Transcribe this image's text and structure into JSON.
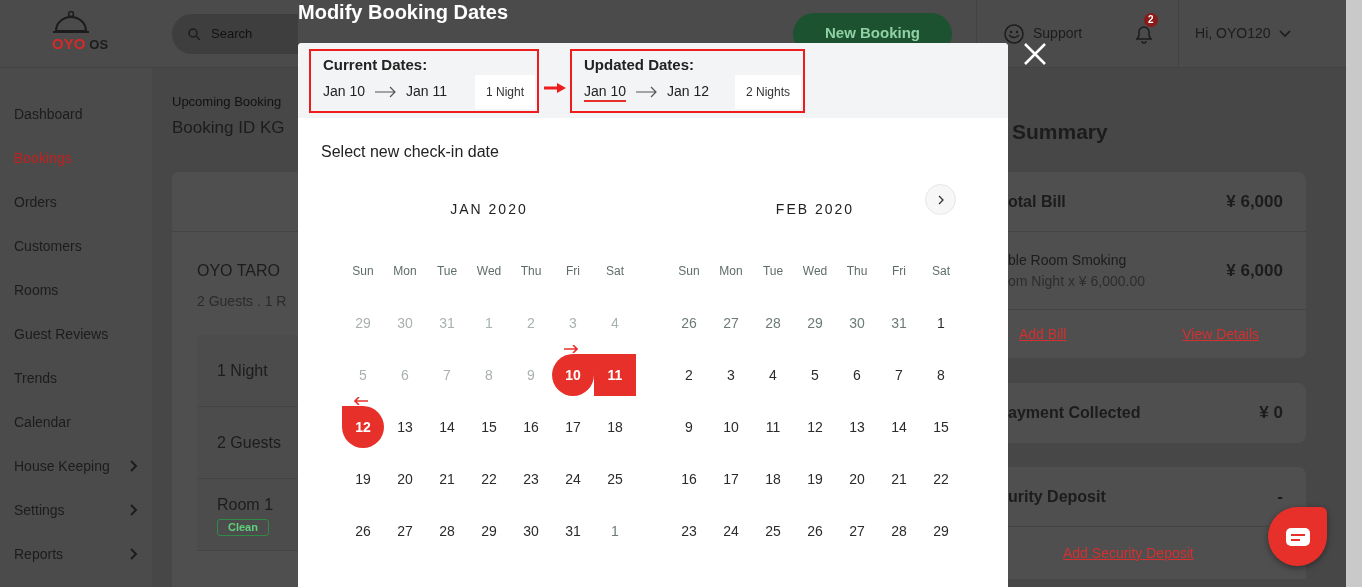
{
  "header": {
    "logo": {
      "brand": "OYO",
      "product": "OS"
    },
    "search": {
      "placeholder": "Search"
    },
    "new_booking": "New Booking",
    "support": "Support",
    "notifications": {
      "count": "2"
    },
    "user": "Hi, OYO120"
  },
  "sidebar": {
    "items": [
      {
        "label": "Dashboard",
        "selected": false,
        "expandable": false
      },
      {
        "label": "Bookings",
        "selected": true,
        "expandable": false
      },
      {
        "label": "Orders",
        "selected": false,
        "expandable": false
      },
      {
        "label": "Customers",
        "selected": false,
        "expandable": false
      },
      {
        "label": "Rooms",
        "selected": false,
        "expandable": false
      },
      {
        "label": "Guest Reviews",
        "selected": false,
        "expandable": false
      },
      {
        "label": "Trends",
        "selected": false,
        "expandable": false
      },
      {
        "label": "Calendar",
        "selected": false,
        "expandable": false
      },
      {
        "label": "House Keeping",
        "selected": false,
        "expandable": true
      },
      {
        "label": "Settings",
        "selected": false,
        "expandable": true
      },
      {
        "label": "Reports",
        "selected": false,
        "expandable": true
      }
    ]
  },
  "booking": {
    "breadcrumb": "Upcoming Booking",
    "title": "Booking ID KG",
    "guest_name": "OYO TARO",
    "subtitle": "2 Guests . 1 R",
    "details": [
      {
        "kind": "text",
        "label": "1 Night"
      },
      {
        "kind": "text",
        "label": "2 Guests"
      },
      {
        "kind": "room",
        "label": "Room 1",
        "status": "Clean"
      }
    ]
  },
  "summary": {
    "title": "Summary",
    "bill": {
      "label": "otal Bill",
      "amount": "¥ 6,000",
      "items": [
        {
          "name": "ble Room Smoking",
          "detail": "om Night x ¥ 6,000.00",
          "amount": "¥ 6,000"
        }
      ],
      "actions": [
        "Add Bill",
        "View Details"
      ]
    },
    "payment": {
      "label": "ayment Collected",
      "amount": "¥ 0"
    },
    "deposit": {
      "label": "urity Deposit",
      "amount": "-",
      "action": "Add Security Deposit"
    }
  },
  "modal": {
    "title": "Modify Booking Dates",
    "current": {
      "label": "Current Dates:",
      "check_in": "Jan 10",
      "check_out": "Jan 11",
      "nights": "1 Night",
      "highlighted": true,
      "check_in_active": false
    },
    "updated": {
      "label": "Updated Dates:",
      "check_in": "Jan 10",
      "check_out": "Jan 12",
      "nights": "2 Nights",
      "highlighted": true,
      "check_in_active": true
    },
    "annotation_arrow": true,
    "prompt": "Select new check-in date",
    "months": [
      {
        "title": "JAN 2020",
        "weekdays": [
          "Sun",
          "Mon",
          "Tue",
          "Wed",
          "Thu",
          "Fri",
          "Sat"
        ],
        "days": [
          {
            "d": "29",
            "kind": "disabled"
          },
          {
            "d": "30",
            "kind": "disabled"
          },
          {
            "d": "31",
            "kind": "disabled"
          },
          {
            "d": "1",
            "kind": "disabled"
          },
          {
            "d": "2",
            "kind": "disabled"
          },
          {
            "d": "3",
            "kind": "disabled"
          },
          {
            "d": "4",
            "kind": "disabled"
          },
          {
            "d": "5",
            "kind": "disabled"
          },
          {
            "d": "6",
            "kind": "disabled"
          },
          {
            "d": "7",
            "kind": "disabled"
          },
          {
            "d": "8",
            "kind": "disabled"
          },
          {
            "d": "9",
            "kind": "disabled"
          },
          {
            "d": "10",
            "kind": "start"
          },
          {
            "d": "11",
            "kind": "range"
          },
          {
            "d": "12",
            "kind": "end"
          },
          {
            "d": "13",
            "kind": "normal"
          },
          {
            "d": "14",
            "kind": "normal"
          },
          {
            "d": "15",
            "kind": "normal"
          },
          {
            "d": "16",
            "kind": "normal"
          },
          {
            "d": "17",
            "kind": "normal"
          },
          {
            "d": "18",
            "kind": "normal"
          },
          {
            "d": "19",
            "kind": "normal"
          },
          {
            "d": "20",
            "kind": "normal"
          },
          {
            "d": "21",
            "kind": "normal"
          },
          {
            "d": "22",
            "kind": "normal"
          },
          {
            "d": "23",
            "kind": "normal"
          },
          {
            "d": "24",
            "kind": "normal"
          },
          {
            "d": "25",
            "kind": "normal"
          },
          {
            "d": "26",
            "kind": "normal"
          },
          {
            "d": "27",
            "kind": "normal"
          },
          {
            "d": "28",
            "kind": "normal"
          },
          {
            "d": "29",
            "kind": "normal"
          },
          {
            "d": "30",
            "kind": "normal"
          },
          {
            "d": "31",
            "kind": "normal"
          },
          {
            "d": "1",
            "kind": "outside"
          }
        ]
      },
      {
        "title": "FEB 2020",
        "weekdays": [
          "Sun",
          "Mon",
          "Tue",
          "Wed",
          "Thu",
          "Fri",
          "Sat"
        ],
        "next_button": true,
        "days": [
          {
            "d": "26",
            "kind": "outside"
          },
          {
            "d": "27",
            "kind": "outside"
          },
          {
            "d": "28",
            "kind": "outside"
          },
          {
            "d": "29",
            "kind": "outside"
          },
          {
            "d": "30",
            "kind": "outside"
          },
          {
            "d": "31",
            "kind": "outside"
          },
          {
            "d": "1",
            "kind": "normal"
          },
          {
            "d": "2",
            "kind": "normal"
          },
          {
            "d": "3",
            "kind": "normal"
          },
          {
            "d": "4",
            "kind": "normal"
          },
          {
            "d": "5",
            "kind": "normal"
          },
          {
            "d": "6",
            "kind": "normal"
          },
          {
            "d": "7",
            "kind": "normal"
          },
          {
            "d": "8",
            "kind": "normal"
          },
          {
            "d": "9",
            "kind": "normal"
          },
          {
            "d": "10",
            "kind": "normal"
          },
          {
            "d": "11",
            "kind": "normal"
          },
          {
            "d": "12",
            "kind": "normal"
          },
          {
            "d": "13",
            "kind": "normal"
          },
          {
            "d": "14",
            "kind": "normal"
          },
          {
            "d": "15",
            "kind": "normal"
          },
          {
            "d": "16",
            "kind": "normal"
          },
          {
            "d": "17",
            "kind": "normal"
          },
          {
            "d": "18",
            "kind": "normal"
          },
          {
            "d": "19",
            "kind": "normal"
          },
          {
            "d": "20",
            "kind": "normal"
          },
          {
            "d": "21",
            "kind": "normal"
          },
          {
            "d": "22",
            "kind": "normal"
          },
          {
            "d": "23",
            "kind": "normal"
          },
          {
            "d": "24",
            "kind": "normal"
          },
          {
            "d": "25",
            "kind": "normal"
          },
          {
            "d": "26",
            "kind": "normal"
          },
          {
            "d": "27",
            "kind": "normal"
          },
          {
            "d": "28",
            "kind": "normal"
          },
          {
            "d": "29",
            "kind": "normal"
          }
        ]
      }
    ]
  }
}
